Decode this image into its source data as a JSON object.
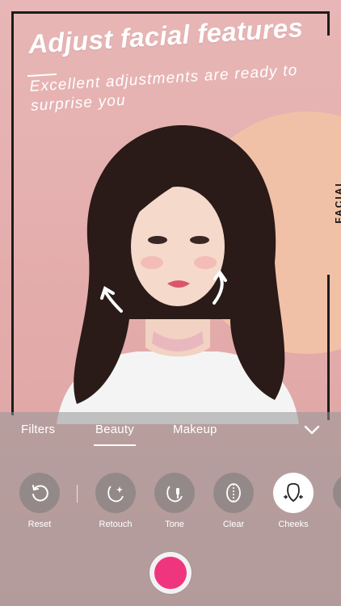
{
  "promo": {
    "headline": "Adjust facial features",
    "subheadline": "Excellent adjustments are ready to surprise you",
    "side_label": "FACIAL"
  },
  "tabs": [
    {
      "label": "Filters",
      "active": false
    },
    {
      "label": "Beauty",
      "active": true
    },
    {
      "label": "Makeup",
      "active": false
    }
  ],
  "tools": [
    {
      "label": "Reset",
      "icon": "reset-icon",
      "selected": false
    },
    {
      "label": "Retouch",
      "icon": "retouch-icon",
      "selected": false
    },
    {
      "label": "Tone",
      "icon": "tone-icon",
      "selected": false
    },
    {
      "label": "Clear",
      "icon": "clear-icon",
      "selected": false
    },
    {
      "label": "Cheeks",
      "icon": "cheeks-icon",
      "selected": true
    }
  ],
  "colors": {
    "background": "#e6b3b3",
    "accent": "#f0357f",
    "frame": "#1c1c1c"
  }
}
